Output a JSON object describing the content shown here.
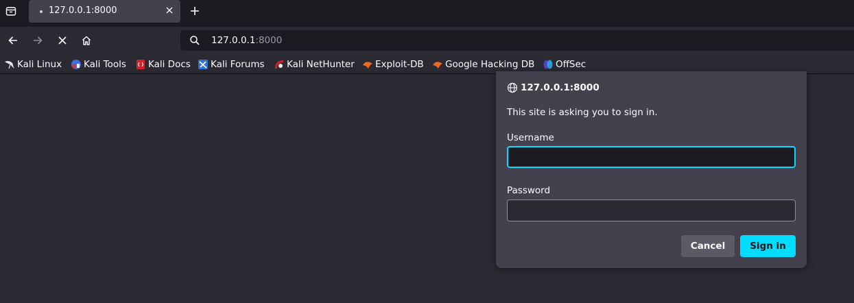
{
  "tab": {
    "title": "127.0.0.1:8000"
  },
  "urlbar": {
    "host": "127.0.0.1",
    "port": ":8000"
  },
  "bookmarks": [
    {
      "label": "Kali Linux",
      "icon": "kali-dragon-icon"
    },
    {
      "label": "Kali Tools",
      "icon": "kali-tools-icon"
    },
    {
      "label": "Kali Docs",
      "icon": "kali-docs-icon"
    },
    {
      "label": "Kali Forums",
      "icon": "kali-forums-icon"
    },
    {
      "label": "Kali NetHunter",
      "icon": "kali-nethunter-icon"
    },
    {
      "label": "Exploit-DB",
      "icon": "exploit-db-icon"
    },
    {
      "label": "Google Hacking DB",
      "icon": "ghdb-icon"
    },
    {
      "label": "OffSec",
      "icon": "offsec-icon"
    }
  ],
  "dialog": {
    "origin": "127.0.0.1:8000",
    "message": "This site is asking you to sign in.",
    "username_label": "Username",
    "username_value": "",
    "password_label": "Password",
    "password_value": "",
    "cancel_label": "Cancel",
    "signin_label": "Sign in"
  },
  "colors": {
    "accent": "#00ddff",
    "toolbar": "#2b2a33",
    "tabstrip": "#1c1b22",
    "panel": "#42414d"
  }
}
